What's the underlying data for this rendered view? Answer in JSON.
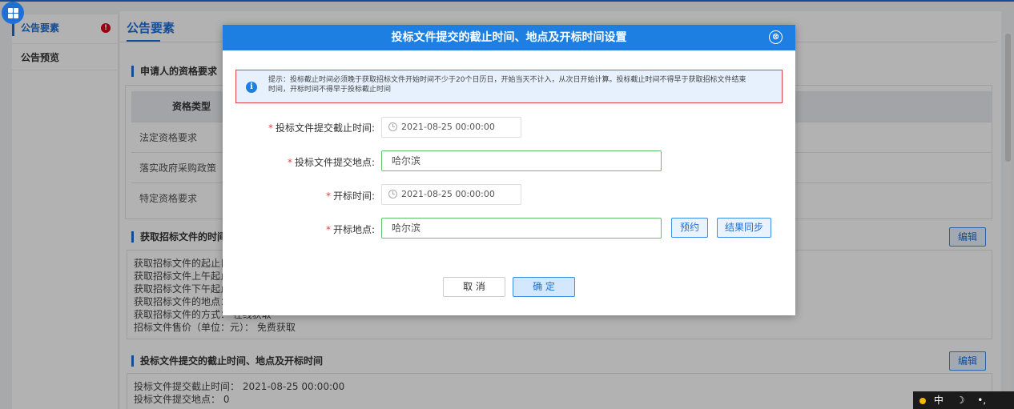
{
  "sidebar": {
    "items": [
      {
        "label": "公告要素",
        "active": true,
        "warning": "!"
      },
      {
        "label": "公告预览",
        "active": false
      }
    ]
  },
  "main": {
    "title": "公告要素",
    "qualification": {
      "heading": "申请人的资格要求",
      "column_header": "资格类型",
      "rows": [
        "法定资格要求",
        "落实政府采购政策",
        "特定资格要求"
      ]
    },
    "bid_docs": {
      "heading": "获取招标文件的时间",
      "edit_label": "编辑",
      "lines": [
        "获取招标文件的起止日",
        "获取招标文件上午起止",
        "获取招标文件下午起止",
        "获取招标文件的地点：",
        "获取招标文件的方式：  在线获取",
        "招标文件售价（单位：元）：  免费获取"
      ]
    },
    "deadline": {
      "heading": "投标文件提交的截止时间、地点及开标时间",
      "edit_label": "编辑",
      "lines": [
        "投标文件提交截止时间：  2021-08-25 00:00:00",
        "投标文件提交地点：  0"
      ]
    }
  },
  "modal": {
    "title": "投标文件提交的截止时间、地点及开标时间设置",
    "close_icon": "⊗",
    "tip_icon": "i",
    "tip_line1": "提示：投标截止时间必须晚于获取招标文件开始时间不少于20个日历日，开始当天不计入，从次日开始计算。投标截止时间不得早于获取招标文件结束",
    "tip_line2": "时间，开标时间不得早于投标截止时间",
    "required_mark": "*",
    "fields": {
      "submit_deadline": {
        "label": "投标文件提交截止时间:",
        "value": "2021-08-25 00:00:00"
      },
      "submit_place": {
        "label": "投标文件提交地点:",
        "value": "哈尔滨"
      },
      "open_time": {
        "label": "开标时间:",
        "value": "2021-08-25 00:00:00"
      },
      "open_place": {
        "label": "开标地点:",
        "value": "哈尔滨"
      }
    },
    "reserve_label": "预约",
    "sync_label": "结果同步",
    "cancel_label": "取 消",
    "ok_label": "确 定"
  },
  "ime": {
    "lang": "中",
    "moon": "☽",
    "dot": "•,",
    "wrench": "🔧"
  },
  "colors": {
    "accent": "#1e6fd6",
    "header_bg": "#1e7fe2",
    "warning": "#d9001b",
    "input_border_valid": "#62c46a"
  }
}
